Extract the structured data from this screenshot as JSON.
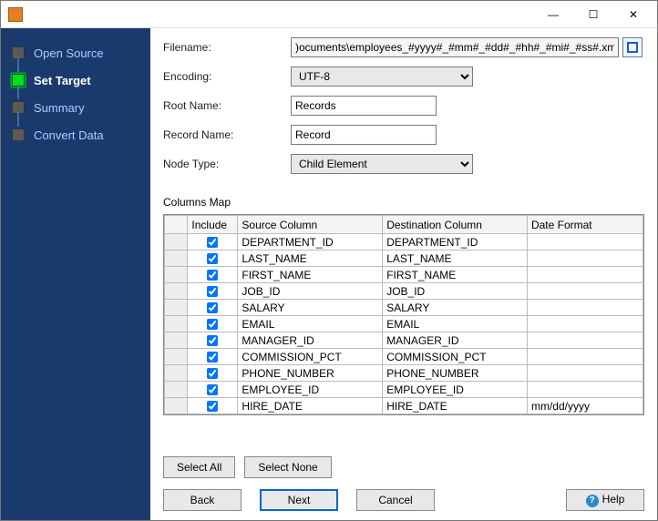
{
  "window": {
    "min": "—",
    "max": "☐",
    "close": "✕"
  },
  "sidebar": {
    "items": [
      {
        "label": "Open Source",
        "active": false
      },
      {
        "label": "Set Target",
        "active": true
      },
      {
        "label": "Summary",
        "active": false
      },
      {
        "label": "Convert Data",
        "active": false
      }
    ]
  },
  "form": {
    "filename_label": "Filename:",
    "filename_value": ")ocuments\\employees_#yyyy#_#mm#_#dd#_#hh#_#mi#_#ss#.xml",
    "encoding_label": "Encoding:",
    "encoding_value": "UTF-8",
    "rootname_label": "Root Name:",
    "rootname_value": "Records",
    "recordname_label": "Record Name:",
    "recordname_value": "Record",
    "nodetype_label": "Node Type:",
    "nodetype_value": "Child Element"
  },
  "columns_map_label": "Columns Map",
  "table": {
    "headers": {
      "include": "Include",
      "source": "Source Column",
      "dest": "Destination Column",
      "datefmt": "Date Format"
    },
    "rows": [
      {
        "include": true,
        "source": "DEPARTMENT_ID",
        "dest": "DEPARTMENT_ID",
        "datefmt": ""
      },
      {
        "include": true,
        "source": "LAST_NAME",
        "dest": "LAST_NAME",
        "datefmt": ""
      },
      {
        "include": true,
        "source": "FIRST_NAME",
        "dest": "FIRST_NAME",
        "datefmt": ""
      },
      {
        "include": true,
        "source": "JOB_ID",
        "dest": "JOB_ID",
        "datefmt": ""
      },
      {
        "include": true,
        "source": "SALARY",
        "dest": "SALARY",
        "datefmt": ""
      },
      {
        "include": true,
        "source": "EMAIL",
        "dest": "EMAIL",
        "datefmt": ""
      },
      {
        "include": true,
        "source": "MANAGER_ID",
        "dest": "MANAGER_ID",
        "datefmt": ""
      },
      {
        "include": true,
        "source": "COMMISSION_PCT",
        "dest": "COMMISSION_PCT",
        "datefmt": ""
      },
      {
        "include": true,
        "source": "PHONE_NUMBER",
        "dest": "PHONE_NUMBER",
        "datefmt": ""
      },
      {
        "include": true,
        "source": "EMPLOYEE_ID",
        "dest": "EMPLOYEE_ID",
        "datefmt": ""
      },
      {
        "include": true,
        "source": "HIRE_DATE",
        "dest": "HIRE_DATE",
        "datefmt": "mm/dd/yyyy"
      }
    ]
  },
  "buttons": {
    "select_all": "Select All",
    "select_none": "Select None",
    "back": "Back",
    "next": "Next",
    "cancel": "Cancel",
    "help": "Help"
  }
}
